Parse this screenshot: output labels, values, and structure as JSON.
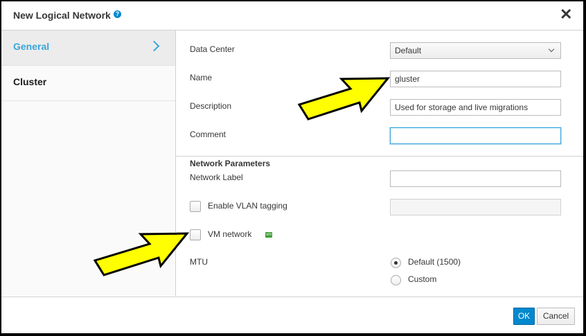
{
  "dialog": {
    "title": "New Logical Network",
    "help_icon": "?",
    "close_icon": "✕"
  },
  "sidebar": {
    "items": [
      {
        "label": "General",
        "active": true
      },
      {
        "label": "Cluster",
        "active": false
      }
    ]
  },
  "general": {
    "data_center": {
      "label": "Data Center",
      "value": "Default"
    },
    "name": {
      "label": "Name",
      "value": "gluster"
    },
    "description": {
      "label": "Description",
      "value": "Used for storage and live migrations"
    },
    "comment": {
      "label": "Comment",
      "value": ""
    }
  },
  "network_parameters": {
    "heading": "Network Parameters",
    "network_label": {
      "label": "Network Label",
      "value": ""
    },
    "vlan_tagging": {
      "label": "Enable VLAN tagging",
      "checked": false,
      "value": ""
    },
    "vm_network": {
      "label": "VM network",
      "checked": false,
      "badge": "vm"
    },
    "mtu": {
      "label": "MTU",
      "options": [
        {
          "label": "Default (1500)",
          "selected": true
        },
        {
          "label": "Custom",
          "selected": false
        }
      ]
    }
  },
  "footer": {
    "ok_label": "OK",
    "cancel_label": "Cancel"
  },
  "colors": {
    "accent": "#39a5dc",
    "primary_button": "#0088ce",
    "annotation_arrow": "#ffff00",
    "vm_badge": "#3f9c35"
  }
}
